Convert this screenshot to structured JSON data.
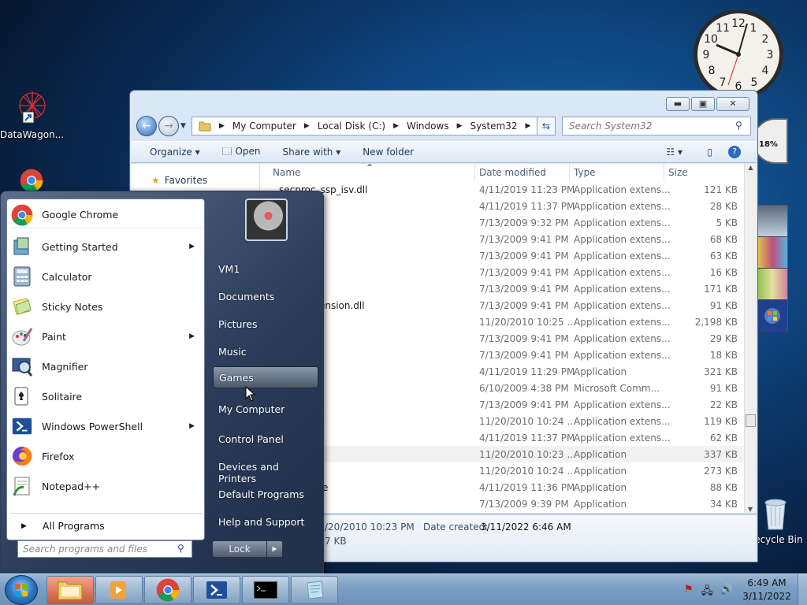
{
  "desktop": {
    "icons": [
      {
        "label": "DataWagon..."
      },
      {
        "label": "Recycle Bin"
      }
    ],
    "gadget_gauge": {
      "percent": "18%"
    }
  },
  "explorer": {
    "address": {
      "segments": [
        "My Computer",
        "Local Disk (C:)",
        "Windows",
        "System32"
      ]
    },
    "search_placeholder": "Search System32",
    "toolbar": {
      "organize": "Organize",
      "open": "Open",
      "share_with": "Share with",
      "new_folder": "New folder"
    },
    "nav": {
      "favorites": "Favorites"
    },
    "columns": {
      "name": "Name",
      "date": "Date modified",
      "type": "Type",
      "size": "Size"
    },
    "files": [
      {
        "name": "secproc_ssp_isv.dll",
        "date": "4/11/2019 11:23 PM",
        "type": "Application extens...",
        "size": "121 KB"
      },
      {
        "name": ".dll",
        "date": "4/11/2019 11:37 PM",
        "type": "Application extens...",
        "size": "28 KB"
      },
      {
        "name": ".dll",
        "date": "7/13/2009 9:32 PM",
        "type": "Application extens...",
        "size": "5 KB"
      },
      {
        "name": "il.dll",
        "date": "7/13/2009 9:41 PM",
        "type": "Application extens...",
        "size": "68 KB"
      },
      {
        "name": "",
        "date": "7/13/2009 9:41 PM",
        "type": "Application extens...",
        "size": "63 KB"
      },
      {
        "name": ".dll",
        "date": "7/13/2009 9:41 PM",
        "type": "Application extens...",
        "size": "16 KB"
      },
      {
        "name": "Api.dll",
        "date": "7/13/2009 9:41 PM",
        "type": "Application extens...",
        "size": "171 KB"
      },
      {
        "name": "ClassExtension.dll",
        "date": "7/13/2009 9:41 PM",
        "type": "Application extens...",
        "size": "91 KB"
      },
      {
        "name": "Cpl.dll",
        "date": "11/20/2010 10:25 ...",
        "type": "Application extens...",
        "size": "2,198 KB"
      },
      {
        "name": "t.dll",
        "date": "7/13/2009 9:41 PM",
        "type": "Application extens...",
        "size": "29 KB"
      },
      {
        "name": "dll",
        "date": "7/13/2009 9:41 PM",
        "type": "Application extens...",
        "size": "18 KB"
      },
      {
        "name": "",
        "date": "4/11/2019 11:29 PM",
        "type": "Application",
        "size": "321 KB"
      },
      {
        "name": "",
        "date": "6/10/2009 4:38 PM",
        "type": "Microsoft Comm...",
        "size": "91 KB"
      },
      {
        "name": "v.dll",
        "date": "7/13/2009 9:41 PM",
        "type": "Application extens...",
        "size": "22 KB"
      },
      {
        "name": ".dll",
        "date": "11/20/2010 10:24 ...",
        "type": "Application extens...",
        "size": "119 KB"
      },
      {
        "name": "ocale.dll",
        "date": "4/11/2019 11:37 PM",
        "type": "Application extens...",
        "size": "62 KB"
      },
      {
        "name": ")",
        "date": "11/20/2010 10:23 ...",
        "type": "Application",
        "size": "337 KB"
      },
      {
        "name": "",
        "date": "11/20/2010 10:24 ...",
        "type": "Application",
        "size": "273 KB"
      },
      {
        "name": "talledDate",
        "date": "4/11/2019 11:36 PM",
        "type": "Application",
        "size": "88 KB"
      },
      {
        "name": "",
        "date": "7/13/2009 9:39 PM",
        "type": "Application",
        "size": "34 KB"
      }
    ],
    "details": {
      "modified": "/20/2010 10:23 PM",
      "created_label": "Date created:",
      "created": "3/11/2022 6:46 AM",
      "size": "7 KB"
    }
  },
  "start_menu": {
    "programs": [
      {
        "label": "Google Chrome",
        "icon": "chrome-icon",
        "arrow": false
      },
      {
        "label": "Getting Started",
        "icon": "getting-started-icon",
        "arrow": true
      },
      {
        "label": "Calculator",
        "icon": "calculator-icon",
        "arrow": false
      },
      {
        "label": "Sticky Notes",
        "icon": "sticky-notes-icon",
        "arrow": false
      },
      {
        "label": "Paint",
        "icon": "paint-icon",
        "arrow": true
      },
      {
        "label": "Magnifier",
        "icon": "magnifier-icon",
        "arrow": false
      },
      {
        "label": "Solitaire",
        "icon": "solitaire-icon",
        "arrow": false
      },
      {
        "label": "Windows PowerShell",
        "icon": "powershell-icon",
        "arrow": true
      },
      {
        "label": "Firefox",
        "icon": "firefox-icon",
        "arrow": false
      },
      {
        "label": "Notepad++",
        "icon": "notepadpp-icon",
        "arrow": false
      }
    ],
    "all_programs": "All Programs",
    "search_placeholder": "Search programs and files",
    "links": [
      "VM1",
      "Documents",
      "Pictures",
      "Music",
      "Games",
      "My Computer",
      "Control Panel",
      "Devices and Printers",
      "Default Programs",
      "Help and Support"
    ],
    "hovered_link": "Games",
    "lock": "Lock"
  },
  "taskbar": {
    "time": "6:49 AM",
    "date": "3/11/2022"
  }
}
